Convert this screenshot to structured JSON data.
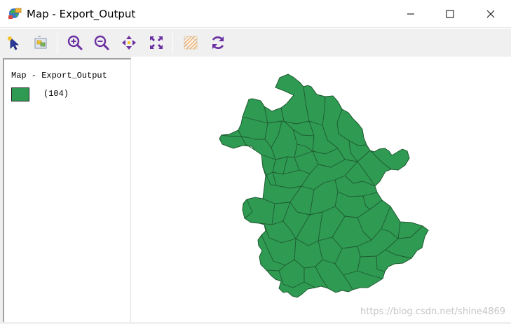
{
  "window": {
    "title": "Map - Export_Output",
    "controls": [
      "minimize-icon",
      "maximize-icon",
      "close-icon"
    ]
  },
  "toolbar": {
    "tools": [
      {
        "name": "select-tool",
        "icon": "pointer-arrow-icon"
      },
      {
        "name": "identify-tool",
        "icon": "identify-icon"
      },
      {
        "name": "zoom-in-tool",
        "icon": "zoom-in-icon"
      },
      {
        "name": "zoom-out-tool",
        "icon": "zoom-out-icon"
      },
      {
        "name": "pan-tool",
        "icon": "pan-arrows-icon"
      },
      {
        "name": "full-extent-tool",
        "icon": "full-extent-icon"
      },
      {
        "name": "layer-pattern-tool",
        "icon": "layer-pattern-icon"
      },
      {
        "name": "refresh-tool",
        "icon": "refresh-icon"
      }
    ]
  },
  "legend": {
    "layer_title": "Map - Export_Output",
    "item_label": "(104)",
    "swatch_color": "#2e9a52"
  },
  "map": {
    "fill_color": "#2e9a52",
    "stroke_color": "#1f5a30"
  },
  "watermark": "https://blog.csdn.net/shine4869"
}
